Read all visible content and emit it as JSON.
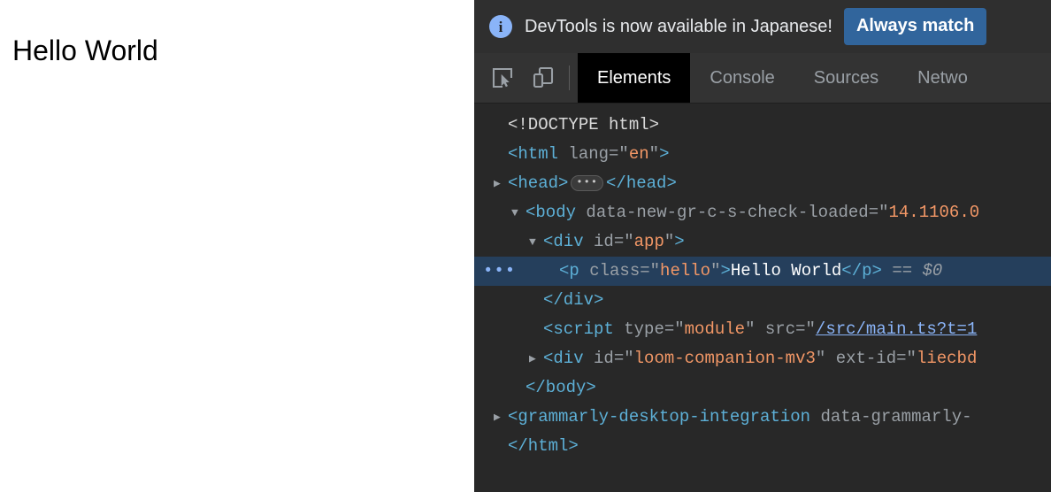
{
  "page": {
    "heading": "Hello World",
    "background_color": "#ffffff",
    "text_color": "#000000"
  },
  "devtools": {
    "background_color": "#282828",
    "banner": {
      "icon": "info-icon",
      "message": "DevTools is now available in Japanese!",
      "button_label": "Always match",
      "button_color": "#31659c",
      "icon_color": "#8ab4f8",
      "background_color": "#2f2f2f"
    },
    "toolbar": {
      "inspect_icon": "inspect-element-icon",
      "device_icon": "device-toolbar-icon"
    },
    "tabs": [
      {
        "label": "Elements",
        "active": true
      },
      {
        "label": "Console",
        "active": false
      },
      {
        "label": "Sources",
        "active": false
      },
      {
        "label": "Netwo",
        "active": false
      }
    ],
    "dom_tree": {
      "selected_row_color": "#253f5c",
      "nodes": [
        {
          "id": "doctype",
          "indent": 1,
          "twisty": "",
          "text": "<!DOCTYPE html>"
        },
        {
          "id": "html-open",
          "indent": 1,
          "twisty": "",
          "tag": "html",
          "attr_name": "lang",
          "attr_value": "en"
        },
        {
          "id": "head",
          "indent": 1,
          "twisty": "collapsed",
          "open_tag": "<head>",
          "ellipsis": "…",
          "close_tag": "</head>"
        },
        {
          "id": "body-open",
          "indent": 2,
          "twisty": "expanded",
          "tag": "body",
          "attr_name": "data-new-gr-c-s-check-loaded",
          "attr_value": "14.1106.0"
        },
        {
          "id": "div-app-open",
          "indent": 3,
          "twisty": "expanded",
          "tag": "div",
          "attr_name": "id",
          "attr_value": "app"
        },
        {
          "id": "p-hello",
          "indent": 4,
          "twisty": "",
          "selected": true,
          "row_dots": "•••",
          "tag": "p",
          "attr_name": "class",
          "attr_value": "hello",
          "text_content": "Hello World",
          "close_tag": "</p>",
          "selection_marker": "== $0"
        },
        {
          "id": "div-app-close",
          "indent": 3,
          "twisty": "",
          "text": "</div>"
        },
        {
          "id": "script",
          "indent": 3,
          "twisty": "",
          "tag": "script",
          "attr_name": "type",
          "attr_value": "module",
          "attr_name_2": "src",
          "attr_value_2": "/src/main.ts?t=1"
        },
        {
          "id": "div-loom",
          "indent": 3,
          "twisty": "collapsed",
          "tag": "div",
          "attr_name": "id",
          "attr_value": "loom-companion-mv3",
          "attr_name_2": "ext-id",
          "attr_value_2": "liecbd"
        },
        {
          "id": "body-close",
          "indent": 2,
          "twisty": "",
          "text": "</body>"
        },
        {
          "id": "grammarly",
          "indent": 1,
          "twisty": "collapsed",
          "tag": "grammarly-desktop-integration",
          "attr_name": "data-grammarly-",
          "attr_value": ""
        },
        {
          "id": "html-close",
          "indent": 1,
          "twisty": "",
          "text": "</html>"
        }
      ]
    }
  }
}
